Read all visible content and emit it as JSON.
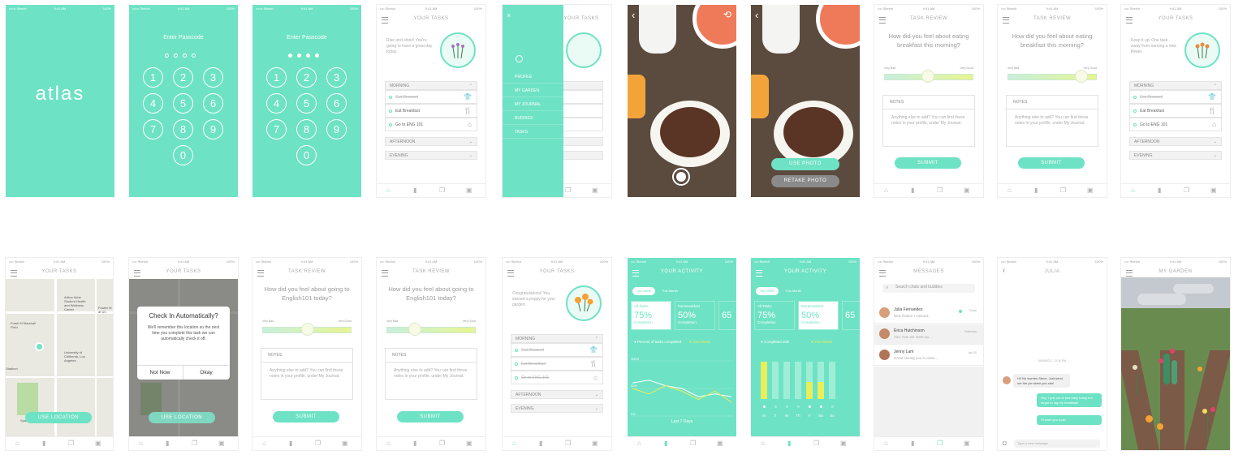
{
  "status": {
    "carrier": "•••••• Sketch",
    "carrier_short": "•••• Sketch",
    "time": "9:41 AM",
    "battery": "100%"
  },
  "splash": {
    "logo": "atlas"
  },
  "passcode": {
    "title": "Enter Passcode",
    "keys": [
      "1",
      "2",
      "3",
      "4",
      "5",
      "6",
      "7",
      "8",
      "9",
      "0"
    ]
  },
  "tasks": {
    "header": "YOUR TASKS",
    "greeting1": "Rise and shine! You're going to have a great day today.",
    "greeting2": "Keep it up! One task away from earning a new flower.",
    "greeting3": "Congratulations! You earned a poppy for your garden.",
    "morning": "MORNING",
    "afternoon": "AFTERNOON",
    "evening": "EVENING",
    "items": [
      "Get Dressed",
      "Eat Breakfast",
      "Go to ENG 101"
    ]
  },
  "menu": {
    "items": [
      "PROFILE",
      "MY GARDEN",
      "MY JOURNAL",
      "BUDDIES",
      "TASKS"
    ],
    "close": "×"
  },
  "photo": {
    "use": "USE PHOTO",
    "retake": "RETAKE PHOTO"
  },
  "review": {
    "header": "TASK REVIEW",
    "q_breakfast": "How did you feel about eating breakfast this morning?",
    "q_english": "How did you feel about going to English101 today?",
    "very_bad": "Very Bad",
    "very_good": "Very Good",
    "notes_label": "NOTES",
    "notes_body": "Anything else to add? You can find these notes in your profile, under My Journal.",
    "submit": "SUBMIT"
  },
  "location": {
    "use_location": "USE LOCATION",
    "dialog_title": "Check In Automatically?",
    "dialog_body": "We'll remember this location so the next time you complete this task we can automatically check it off.",
    "not_now": "Not Now",
    "okay": "Okay",
    "labels": [
      "Arthur Ashe Student Health and Wellness Center",
      "Frank M Marshall Field",
      "University of California, Los Angeles",
      "Spaulding Field",
      "Fowler M at UC",
      "Stadium"
    ]
  },
  "activity": {
    "header": "YOUR ACTIVITY",
    "this_week": "This Week",
    "this_month": "This Month",
    "card1_title": "All Tasks",
    "card1_value": "75%",
    "card1_sub": "Completion",
    "card2_title": "Eat Breakfast",
    "card2_value": "50%",
    "card2_sub": "Completion",
    "card3_value": "65",
    "legend_a": "Percent of tasks completed",
    "legend_b": "Your Mood",
    "legend_c": "Completed task",
    "axis_top": "100%",
    "axis_mid": "50%",
    "axis_bottom": "0%",
    "footer": "Last 7 Days",
    "days": [
      "M",
      "T",
      "W",
      "Th",
      "F",
      "Sa",
      "Su"
    ]
  },
  "chart_data": [
    {
      "type": "line",
      "x": [
        "M",
        "T",
        "W",
        "Th",
        "F",
        "Sa",
        "Su"
      ],
      "series": [
        {
          "name": "Percent of tasks completed",
          "values": [
            60,
            65,
            55,
            50,
            35,
            40,
            35
          ]
        },
        {
          "name": "Your Mood",
          "values": [
            50,
            40,
            55,
            45,
            30,
            45,
            25
          ]
        }
      ],
      "ylim": [
        0,
        100
      ]
    },
    {
      "type": "bar",
      "categories": [
        "M",
        "T",
        "W",
        "Th",
        "F",
        "Sa",
        "Su"
      ],
      "series": [
        {
          "name": "Completed task",
          "values": [
            100,
            100,
            100,
            100,
            100,
            100,
            100
          ]
        },
        {
          "name": "Your Mood",
          "values": [
            100,
            0,
            0,
            0,
            45,
            45,
            0
          ]
        }
      ],
      "ylim": [
        0,
        100
      ]
    }
  ],
  "messages": {
    "header": "MESSAGES",
    "search": "Search chats and buddies",
    "threads": [
      {
        "name": "Julia Fernandez",
        "preview": "New flower! I noticed...",
        "date": "Today"
      },
      {
        "name": "Erica Hutchinson",
        "preview": "You: Can we meet up...",
        "date": "Yesterday"
      },
      {
        "name": "Jenny Lam",
        "preview": "Great seeing you in class...",
        "date": "Apr 20"
      }
    ]
  },
  "chat": {
    "header": "JULIA",
    "date": "04/06/2017, 12:30 PM",
    "in1": "Hi! No worries Steve. Just send me the pic when you can!",
    "out1": "Hey, I just out of bed early today but forgot to log my breakfast!",
    "out2": "I'll send you a pic",
    "placeholder": "Type a new message"
  },
  "garden": {
    "header": "MY GARDEN"
  },
  "icons": {
    "home": "home-icon",
    "stats": "stats-icon",
    "chat": "chat-icon",
    "journal": "journal-icon"
  },
  "colors": {
    "accent": "#6ee2c4",
    "mood": "#e8ef5b"
  }
}
